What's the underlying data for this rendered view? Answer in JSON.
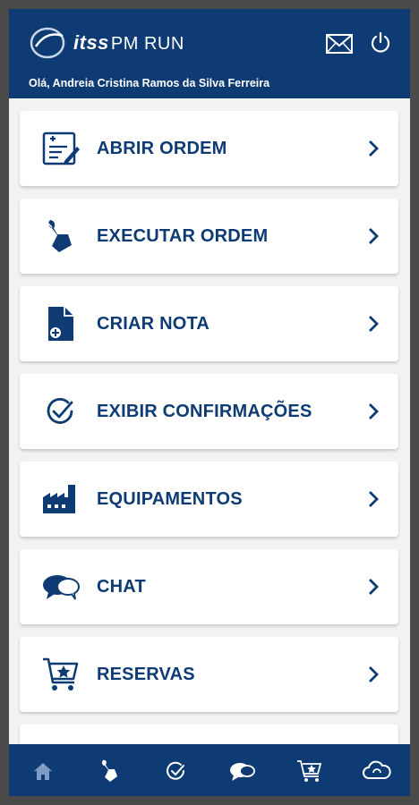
{
  "header": {
    "brand_bold": "itss",
    "brand_rest": "PM RUN",
    "greeting": "Olá, Andreia Cristina Ramos da Silva Ferreira",
    "icons": [
      "mail-icon",
      "power-icon"
    ]
  },
  "menu": {
    "items": [
      {
        "label": "ABRIR ORDEM",
        "icon": "form-icon"
      },
      {
        "label": "EXECUTAR ORDEM",
        "icon": "wrench-icon"
      },
      {
        "label": "CRIAR NOTA",
        "icon": "add-note-icon"
      },
      {
        "label": "EXIBIR CONFIRMAÇÕES",
        "icon": "check-circle-icon"
      },
      {
        "label": "EQUIPAMENTOS",
        "icon": "factory-icon"
      },
      {
        "label": "CHAT",
        "icon": "chat-icon"
      },
      {
        "label": "RESERVAS",
        "icon": "cart-star-icon"
      }
    ]
  },
  "bottom_nav": {
    "items": [
      "home-icon",
      "wrench-icon",
      "check-circle-icon",
      "chat-icon",
      "cart-star-icon",
      "cloud-icon"
    ]
  },
  "colors": {
    "primary": "#0e3b73",
    "card": "#ffffff",
    "background": "#f2f2f2"
  }
}
